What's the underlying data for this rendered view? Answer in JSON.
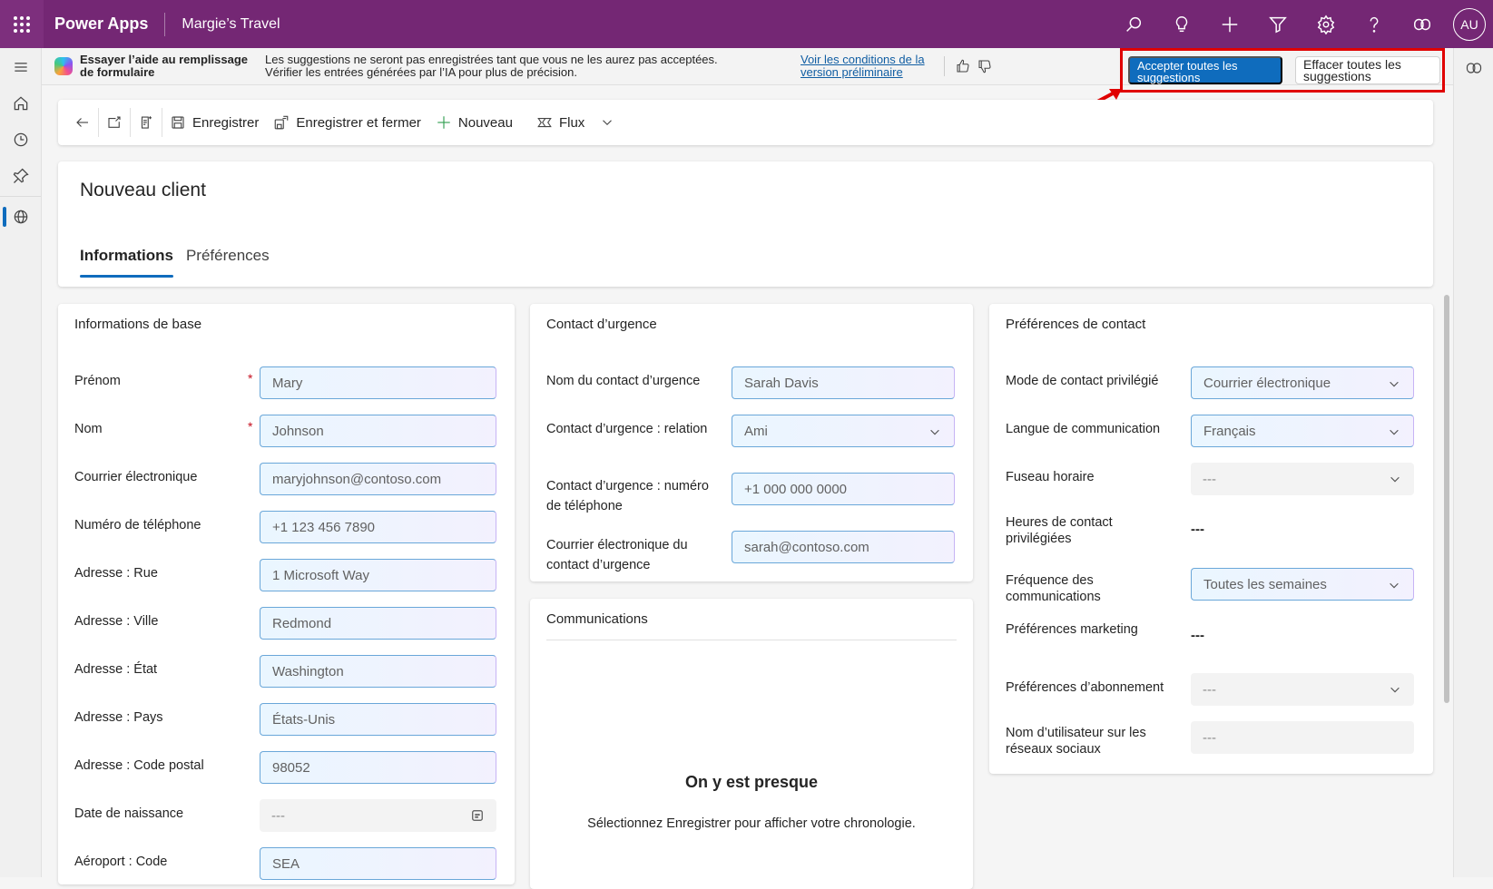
{
  "topbar": {
    "app_name": "Power Apps",
    "environment": "Margie’s Travel",
    "icons": [
      "search-icon",
      "lightbulb-icon",
      "plus-icon",
      "filter-icon",
      "settings-icon",
      "help-icon",
      "copilot-icon"
    ],
    "avatar_initials": "AU",
    "brand_color": "#742774"
  },
  "leftnav": {
    "items": [
      {
        "name": "menu",
        "icon": "hamburger-icon"
      },
      {
        "name": "home",
        "icon": "home-icon"
      },
      {
        "name": "recent",
        "icon": "clock-icon"
      },
      {
        "name": "pinned",
        "icon": "pin-icon"
      },
      {
        "name": "web-resources",
        "icon": "globe-icon",
        "active": true
      }
    ]
  },
  "banner": {
    "title": "Essayer l’aide au remplissage de formulaire",
    "message_line1": "Les suggestions ne seront pas enregistrées tant que vous ne les aurez pas acceptées.",
    "message_line2": "Vérifier les entrées générées par l’IA pour plus de précision.",
    "link": "Voir les conditions de la version préliminaire",
    "accept_all": "Accepter toutes les suggestions",
    "clear_all": "Effacer toutes les suggestions"
  },
  "commandbar": {
    "save": "Enregistrer",
    "save_close": "Enregistrer et fermer",
    "new": "Nouveau",
    "flow": "Flux"
  },
  "record": {
    "title": "Nouveau client",
    "tabs": [
      {
        "label": "Informations",
        "active": true
      },
      {
        "label": "Préférences",
        "active": false
      }
    ]
  },
  "basic_info": {
    "title": "Informations de base",
    "fields": [
      {
        "label": "Prénom",
        "value": "Mary",
        "required": true
      },
      {
        "label": "Nom",
        "value": "Johnson",
        "required": true
      },
      {
        "label": "Courrier électronique",
        "value": "maryjohnson@contoso.com"
      },
      {
        "label": "Numéro de téléphone",
        "value": "+1 123 456 7890"
      },
      {
        "label": "Adresse : Rue",
        "value": "1 Microsoft Way"
      },
      {
        "label": "Adresse : Ville",
        "value": "Redmond"
      },
      {
        "label": "Adresse : État",
        "value": "Washington"
      },
      {
        "label": "Adresse : Pays",
        "value": "États-Unis"
      },
      {
        "label": "Adresse : Code postal",
        "value": "98052"
      },
      {
        "label": "Date de naissance",
        "value": "---"
      },
      {
        "label": "Aéroport : Code",
        "value": "SEA"
      }
    ]
  },
  "emergency": {
    "title": "Contact d’urgence",
    "fields": [
      {
        "label": "Nom du contact d’urgence",
        "value": "Sarah Davis"
      },
      {
        "label": "Contact d’urgence : relation",
        "value": "Ami"
      },
      {
        "label": "Contact d’urgence : numéro de téléphone",
        "value": "+1 000 000 0000"
      },
      {
        "label": "Courrier électronique du contact d’urgence",
        "value": "sarah@contoso.com"
      }
    ]
  },
  "communications": {
    "title": "Communications",
    "empty_title": "On y est presque",
    "empty_message": "Sélectionnez Enregistrer pour afficher votre chronologie."
  },
  "contact_prefs": {
    "title": "Préférences de contact",
    "fields": [
      {
        "label": "Mode de contact privilégié",
        "value": "Courrier électronique"
      },
      {
        "label": "Langue de communication",
        "value": "Français"
      },
      {
        "label": "Fuseau horaire",
        "value": "---"
      },
      {
        "label": "Heures de contact privilégiées",
        "value": "---"
      },
      {
        "label": "Fréquence des communications",
        "value": "Toutes les semaines"
      },
      {
        "label": "Préférences marketing",
        "value": "---"
      },
      {
        "label": "Préférences d’abonnement",
        "value": "---"
      },
      {
        "label": "Nom d’utilisateur sur les réseaux sociaux",
        "value": "---"
      }
    ]
  }
}
